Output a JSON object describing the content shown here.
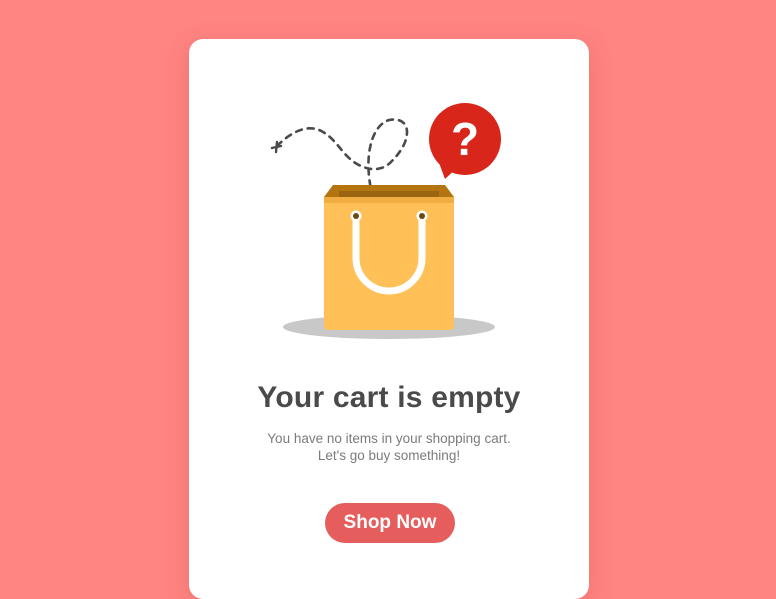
{
  "empty_cart": {
    "title": "Your cart is empty",
    "message_line1": "You have no items in your shopping cart.",
    "message_line2": "Let's go buy something!",
    "cta_label": "Shop Now"
  },
  "illustration": {
    "speech_bubble_text": "?",
    "icons": [
      "shopping-bag-icon",
      "question-bubble-icon",
      "dashed-flight-path-icon"
    ]
  },
  "colors": {
    "background": "#ff8582",
    "card": "#ffffff",
    "title": "#4a4a4a",
    "message": "#7b7b7b",
    "button": "#e55d5d",
    "bag": "#ffc157",
    "bag_inner": "#b4740f",
    "bubble": "#d9261b",
    "shadow": "#c8c8c8"
  }
}
